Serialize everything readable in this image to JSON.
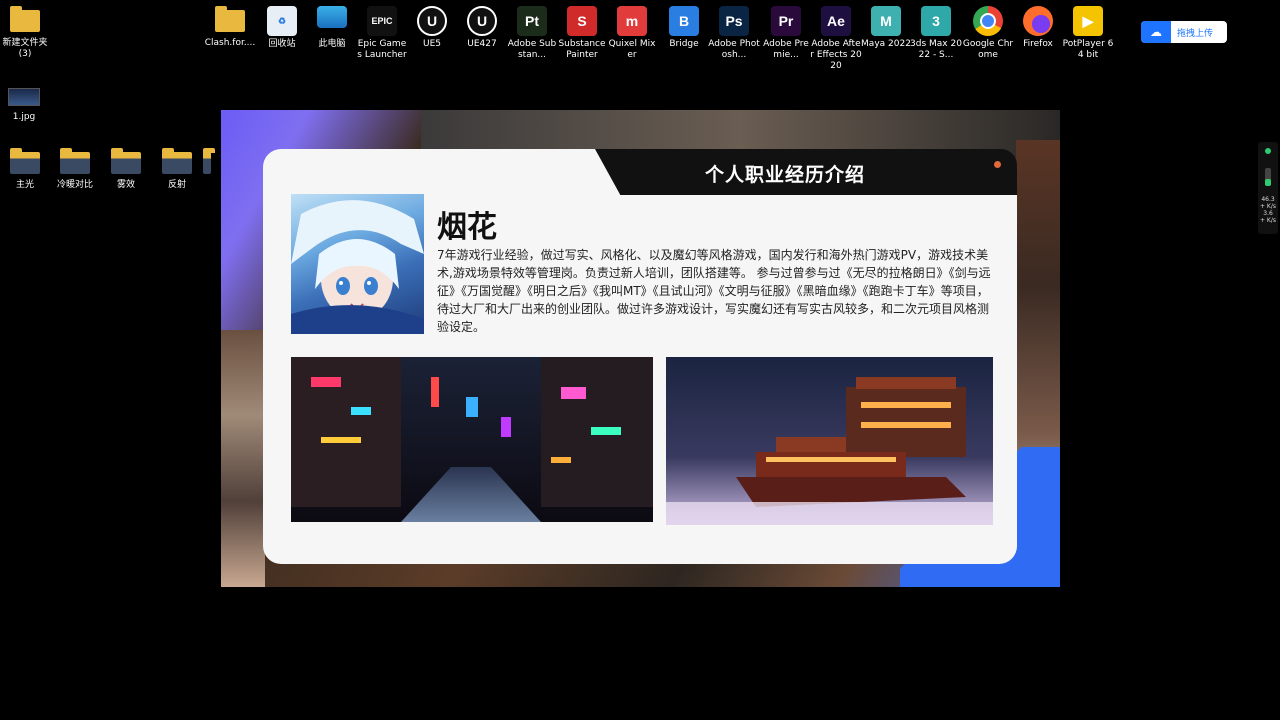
{
  "desktop": {
    "top_icons": [
      {
        "label": "新建文件夹\n(3)",
        "icon": "folder-icon"
      },
      {
        "label": "Clash.for....",
        "icon": "folder-icon"
      },
      {
        "label": "回收站",
        "icon": "recycle-bin-icon"
      },
      {
        "label": "此电脑",
        "icon": "computer-icon"
      },
      {
        "label": "Epic Games Launcher",
        "icon": "epic-icon",
        "text": "EPIC",
        "color": "#111111"
      },
      {
        "label": "UE5",
        "icon": "unreal-icon",
        "text": "U",
        "color": "#111111"
      },
      {
        "label": "UE427",
        "icon": "unreal-icon",
        "text": "U",
        "color": "#111111"
      },
      {
        "label": "Adobe Substan...",
        "icon": "substance-painter-icon",
        "text": "Pt",
        "color": "#1c2c1a"
      },
      {
        "label": "Substance Painter",
        "icon": "substance-icon",
        "text": "S",
        "color": "#d12a2a"
      },
      {
        "label": "Quixel Mixer",
        "icon": "mixer-icon",
        "text": "m",
        "color": "#e23b3b"
      },
      {
        "label": "Bridge",
        "icon": "bridge-icon",
        "text": "B",
        "color": "#2a7de1"
      },
      {
        "label": "Adobe Photosh...",
        "icon": "photoshop-icon",
        "text": "Ps",
        "color": "#0a2544"
      },
      {
        "label": "Adobe Premie...",
        "icon": "premiere-icon",
        "text": "Pr",
        "color": "#2a0a3a"
      },
      {
        "label": "Adobe After Effects 2020",
        "icon": "after-effects-icon",
        "text": "Ae",
        "color": "#1d1040"
      },
      {
        "label": "Maya 2022",
        "icon": "maya-icon",
        "text": "M",
        "color": "#3fb0b0"
      },
      {
        "label": "3ds Max 2022 - S...",
        "icon": "3dsmax-icon",
        "text": "3",
        "color": "#2ea8a8"
      },
      {
        "label": "Google Chrome",
        "icon": "chrome-icon",
        "text": "",
        "color": "#e8e8e8"
      },
      {
        "label": "Firefox",
        "icon": "firefox-icon",
        "text": "",
        "color": "#ff6d2c"
      },
      {
        "label": "PotPlayer 64 bit",
        "icon": "potplayer-icon",
        "text": "▶",
        "color": "#f5c400"
      }
    ],
    "side_items": [
      {
        "label": "1.jpg",
        "icon": "image-file-icon"
      }
    ],
    "folders_row": [
      {
        "label": "主光"
      },
      {
        "label": "冷暖对比"
      },
      {
        "label": "雾效"
      },
      {
        "label": "反射"
      },
      {
        "label": ""
      }
    ],
    "upload_button": "拖拽上传",
    "gadget": {
      "line1": "46.3",
      "line2": "+ K/s",
      "line3": "3.6",
      "line4": "+ K/s"
    }
  },
  "slide": {
    "title": "个人职业经历介绍",
    "name": "烟花",
    "description": "7年游戏行业经验，做过写实、风格化、以及魔幻等风格游戏，国内发行和海外热门游戏PV，游戏技术美术,游戏场景特效等管理岗。负责过新人培训，团队搭建等。 参与过曾参与过《无尽的拉格朗日》《剑与远征》《万国觉醒》《明日之后》《我叫MT》《且试山河》《文明与征服》《黑暗血缘》《跑跑卡丁车》等项目，待过大厂和大厂出来的创业团队。做过许多游戏设计，写实魔幻还有写实古风较多，和二次元项目风格测验设定。"
  }
}
